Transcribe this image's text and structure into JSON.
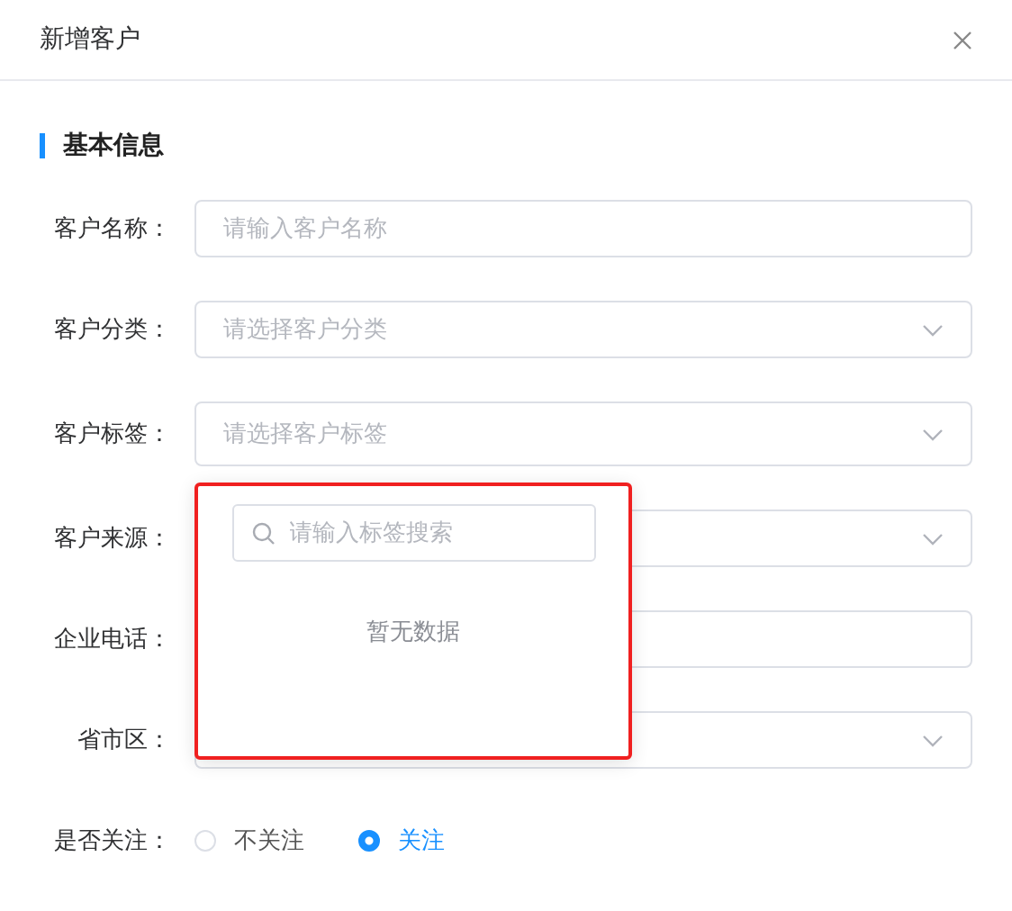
{
  "dialog": {
    "title": "新增客户"
  },
  "section": {
    "title": "基本信息"
  },
  "fields": [
    {
      "label": "客户名称：",
      "kind": "input",
      "placeholder": "请输入客户名称"
    },
    {
      "label": "客户分类：",
      "kind": "select",
      "placeholder": "请选择客户分类"
    },
    {
      "label": "客户标签：",
      "kind": "select",
      "placeholder": "请选择客户标签",
      "expanded": true
    },
    {
      "label": "客户来源：",
      "kind": "select"
    },
    {
      "label": "企业电话：",
      "kind": "input"
    },
    {
      "label": "省市区：",
      "kind": "select"
    }
  ],
  "dropdown": {
    "search_placeholder": "请输入标签搜索",
    "empty_text": "暂无数据",
    "highlighted": true
  },
  "follow": {
    "label": "是否关注：",
    "options": [
      {
        "label": "不关注",
        "selected": false
      },
      {
        "label": "关注",
        "selected": true
      }
    ]
  }
}
